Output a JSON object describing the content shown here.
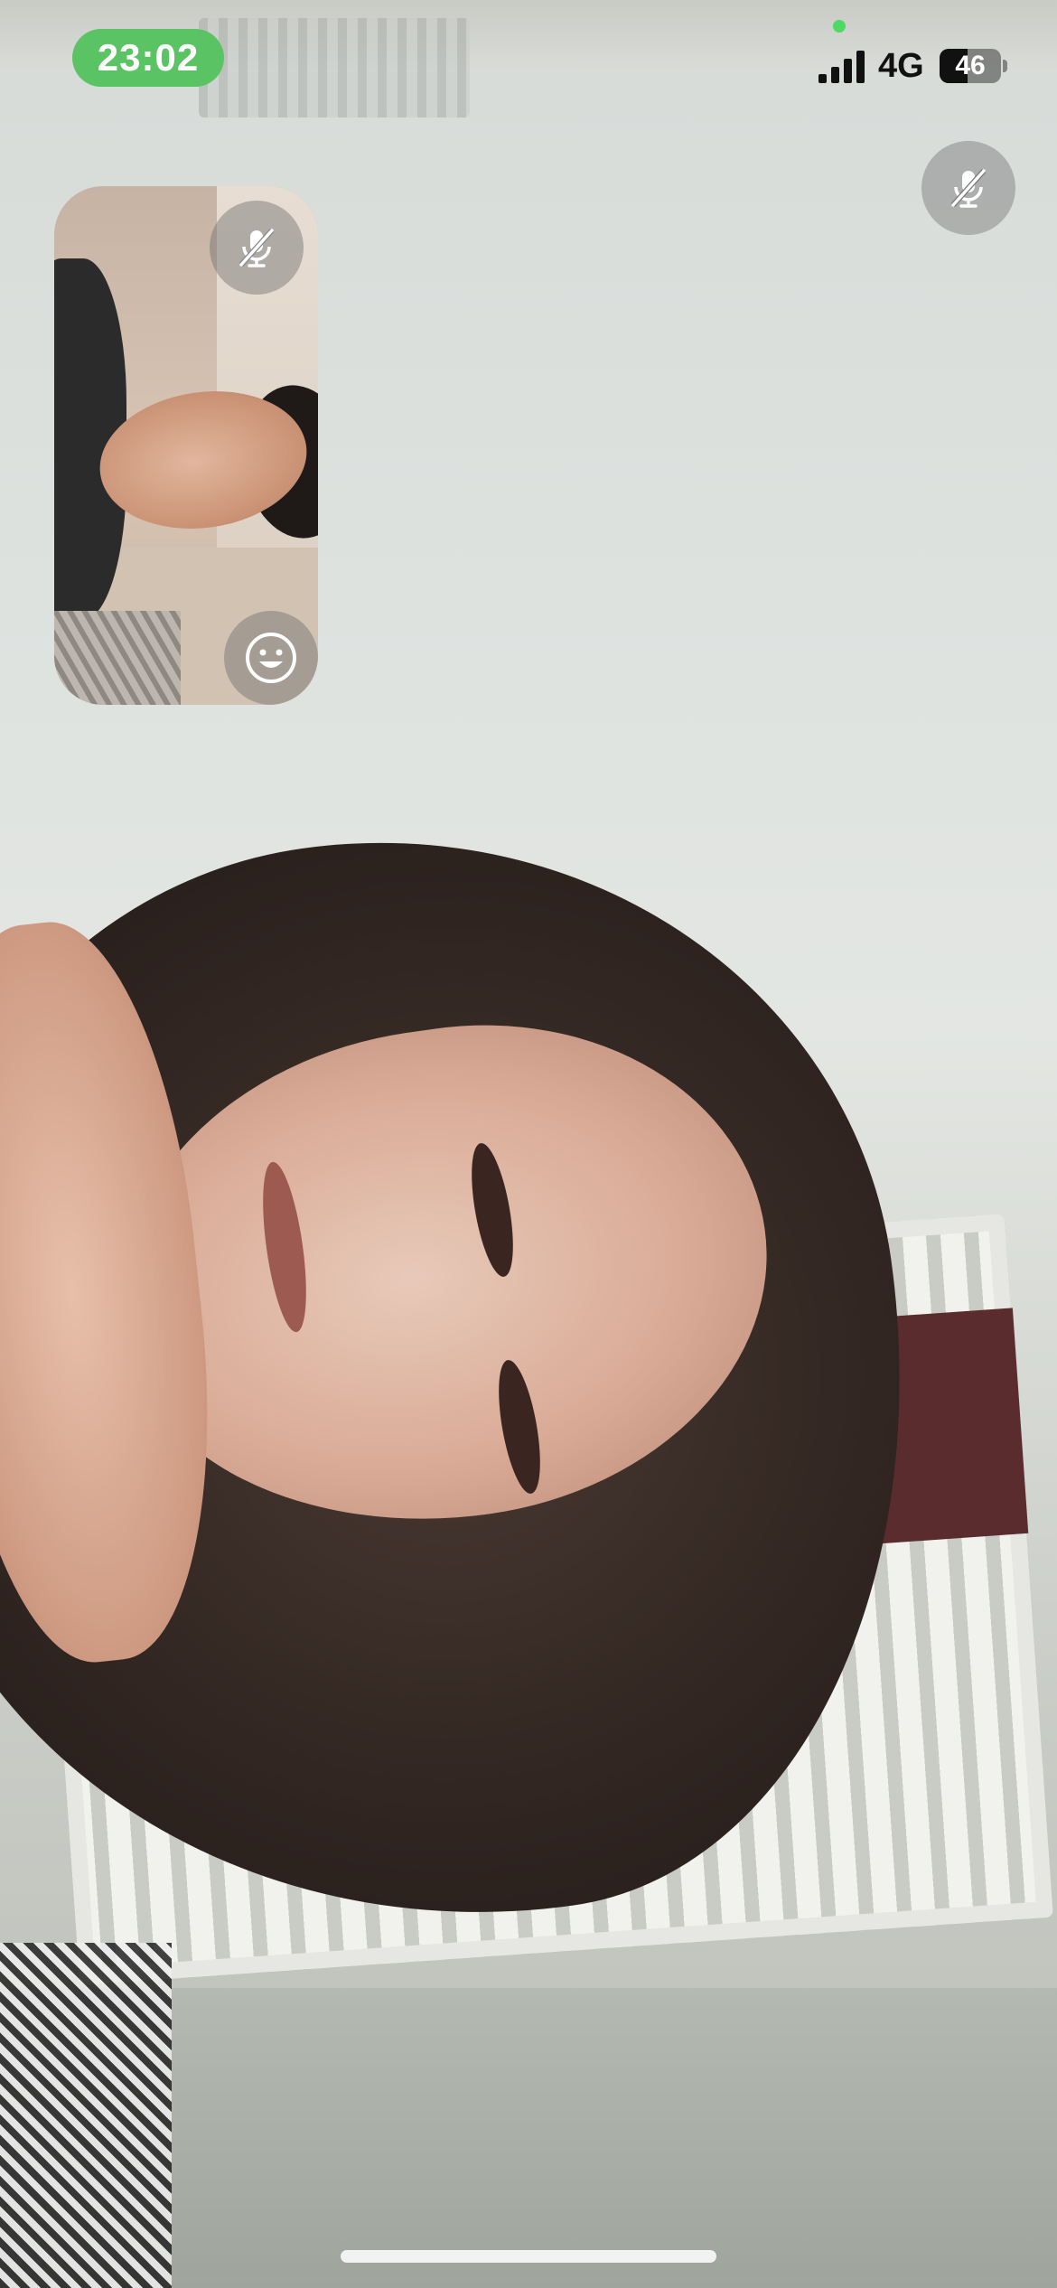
{
  "status_bar": {
    "time": "23:02",
    "network": "4G",
    "battery_level": "46",
    "battery_fraction": 0.46,
    "signal_bars": 4,
    "pill_color": "#5ac363",
    "privacy_indicator_color": "#4cd964"
  },
  "call": {
    "remote_mute_icon": "mic-off-icon",
    "self_mute_icon": "mic-off-icon",
    "effects_icon": "smiley-face-icon"
  }
}
